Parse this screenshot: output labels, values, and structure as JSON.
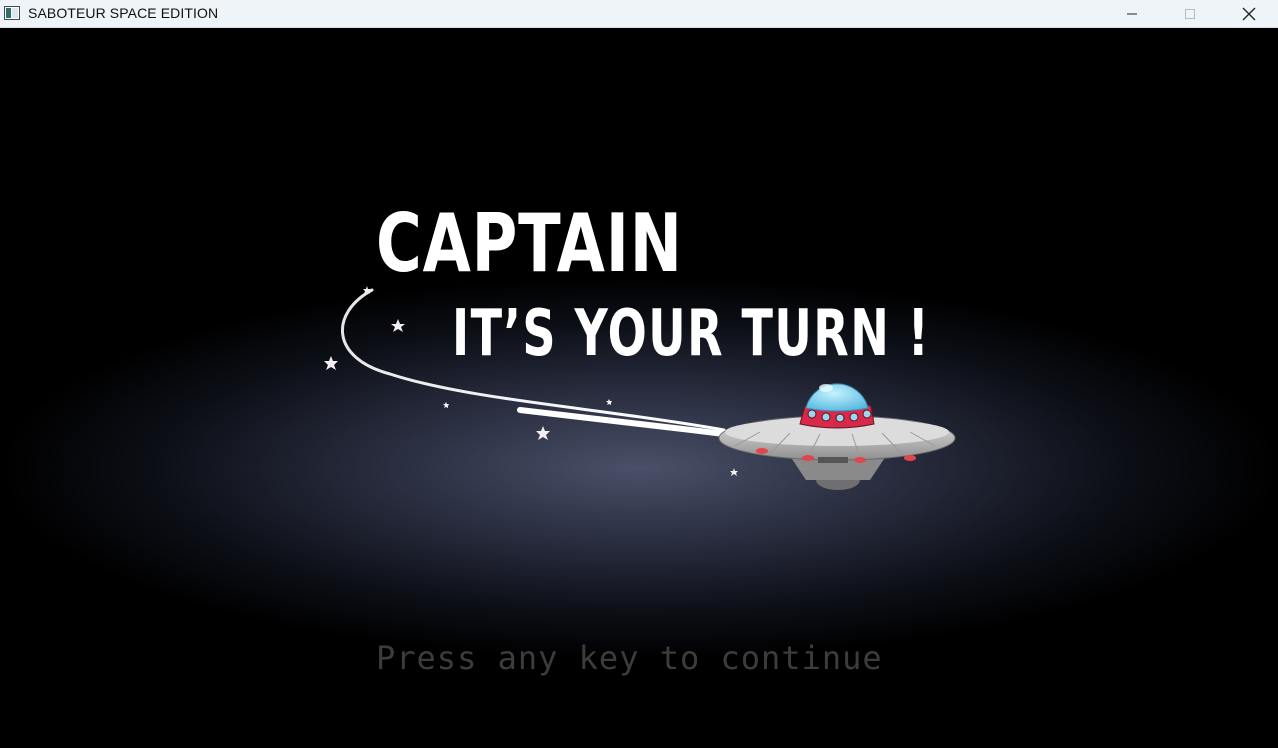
{
  "window": {
    "title": "SABOTEUR SPACE EDITION",
    "controls": {
      "minimize": "minimize",
      "maximize": "maximize",
      "close": "close"
    }
  },
  "screen": {
    "headline": "CAPTAIN",
    "subheadline": "IT’S YOUR TURN !",
    "prompt": "Press any key to continue"
  },
  "icons": [
    "app-icon",
    "minimize-icon",
    "maximize-icon",
    "close-icon",
    "ufo-icon",
    "star-icon"
  ],
  "colors": {
    "background": "#000000",
    "titlebar": "#eff4f9",
    "headline": "#ffffff",
    "prompt": "#3c3c3c",
    "ufo_dome": "#7fd4f0",
    "ufo_band": "#d8294a",
    "ufo_body": "#c7c7c7"
  }
}
